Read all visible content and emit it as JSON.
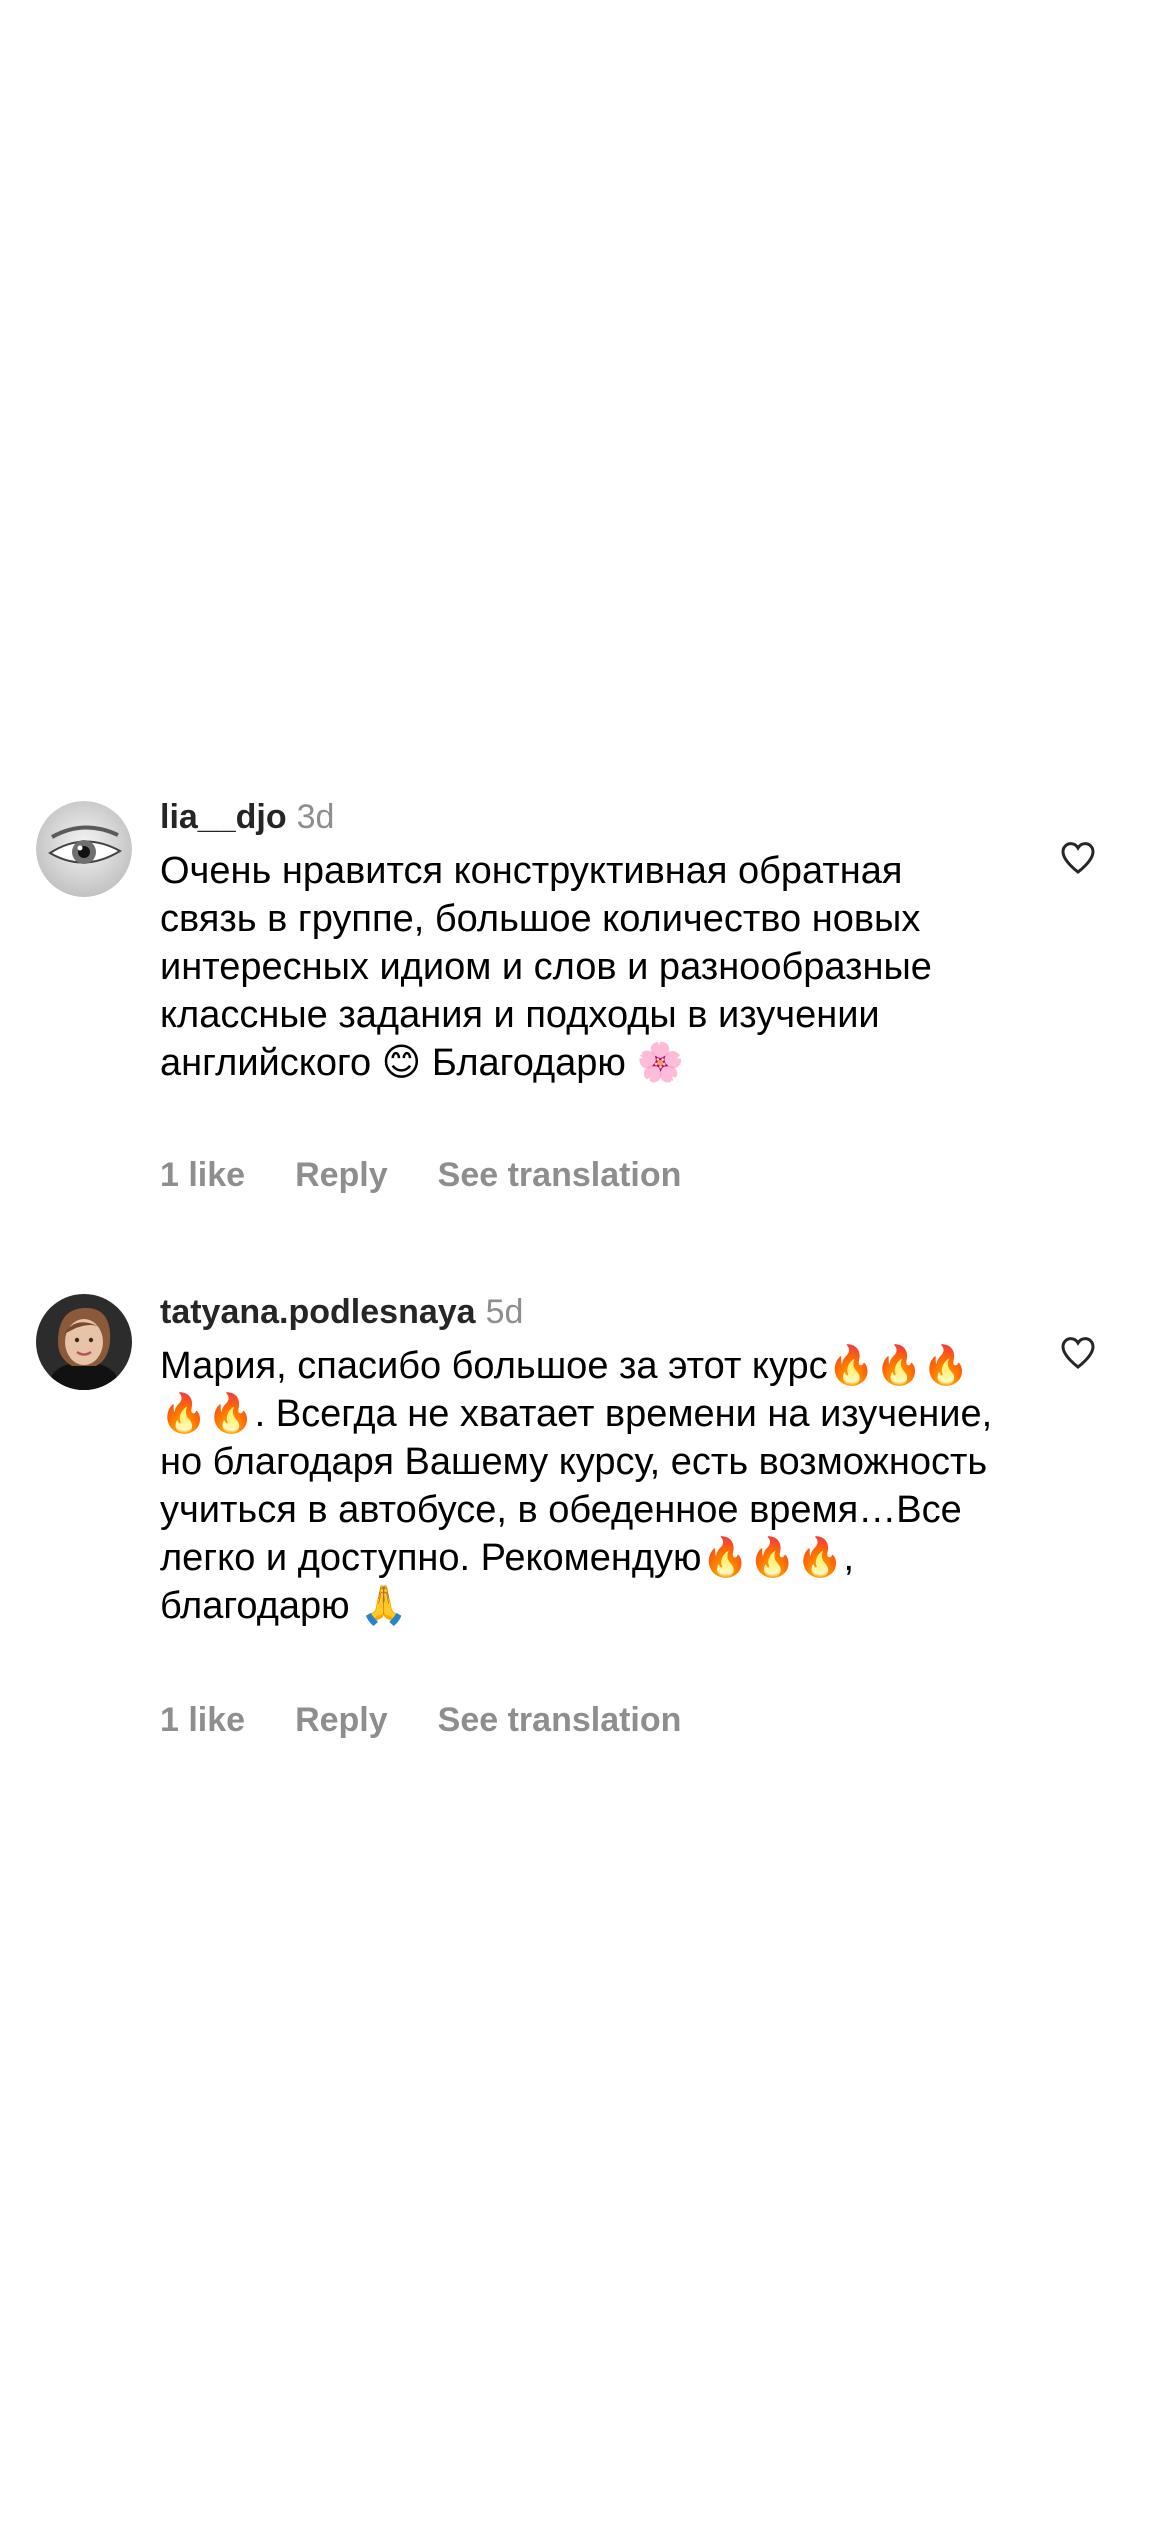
{
  "comments": [
    {
      "username": "lia__djo",
      "time": "3d",
      "text": "Очень нравится конструктивная обратная связь в группе, большое количество новых интересных идиом и слов и разнообразные классные задания и подходы в изучении английского 😊 Благодарю 🌸",
      "likes": "1 like",
      "reply": "Reply",
      "translate": "See translation",
      "like_icon": "heart-outline-icon",
      "avatar_icon": "eye-avatar"
    },
    {
      "username": "tatyana.podlesnaya",
      "time": "5d",
      "text": "Мария, спасибо большое за этот курс🔥🔥🔥🔥🔥. Всегда не хватает времени на изучение, но благодаря Вашему курсу, есть возможность учиться в автобусе, в обеденное время…Все легко и доступно. Рекомендую🔥🔥🔥, благодарю 🙏",
      "likes": "1 like",
      "reply": "Reply",
      "translate": "See translation",
      "like_icon": "heart-outline-icon",
      "avatar_icon": "profile-photo-avatar"
    }
  ],
  "colors": {
    "username": "#262626",
    "secondary": "#8e8e8e",
    "text": "#000000",
    "background": "#ffffff"
  }
}
